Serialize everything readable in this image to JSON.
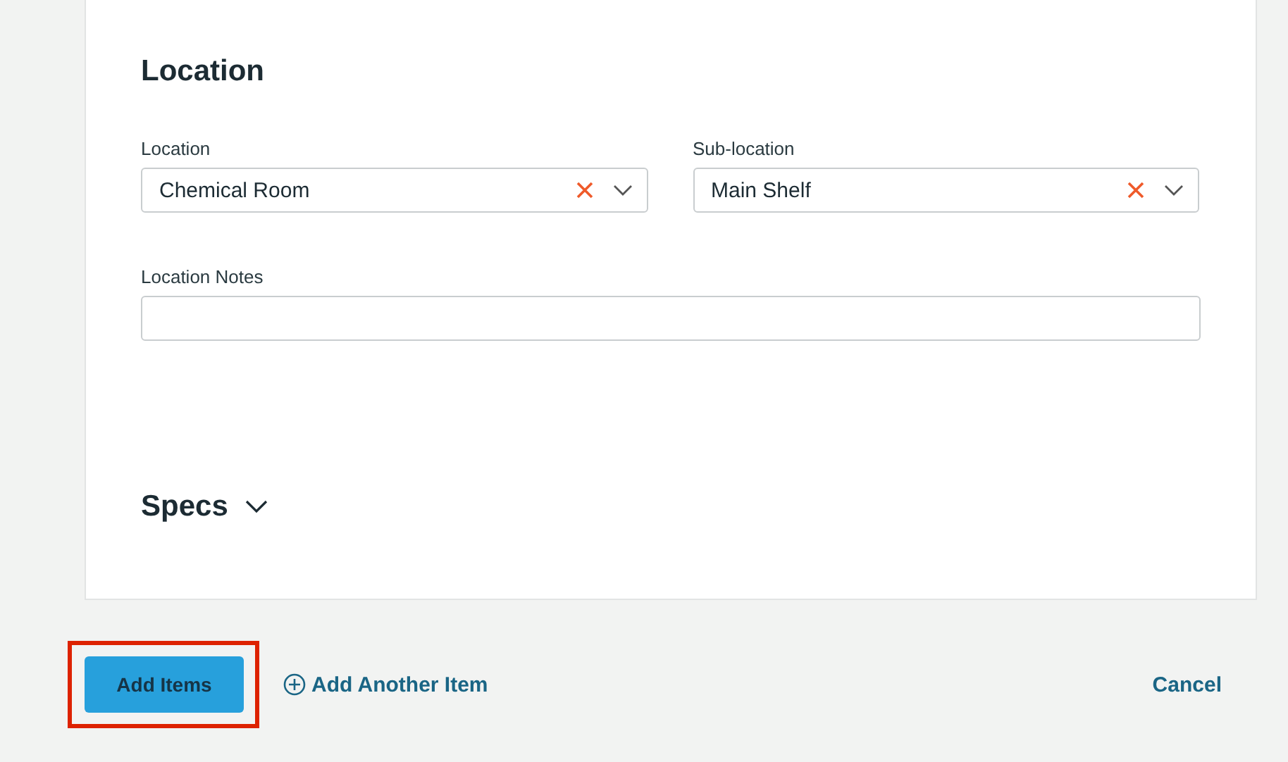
{
  "location_section": {
    "heading": "Location",
    "fields": [
      {
        "label": "Location",
        "value": "Chemical Room",
        "clearable": true
      },
      {
        "label": "Sub-location",
        "value": "Main Shelf",
        "clearable": true
      }
    ],
    "notes": {
      "label": "Location Notes"
    }
  },
  "specs_section": {
    "heading": "Specs",
    "expanded": false
  },
  "footer": {
    "primary": {
      "label": "Add Items",
      "highlighted": true
    },
    "add_another": "Add Another Item",
    "cancel": "Cancel"
  }
}
